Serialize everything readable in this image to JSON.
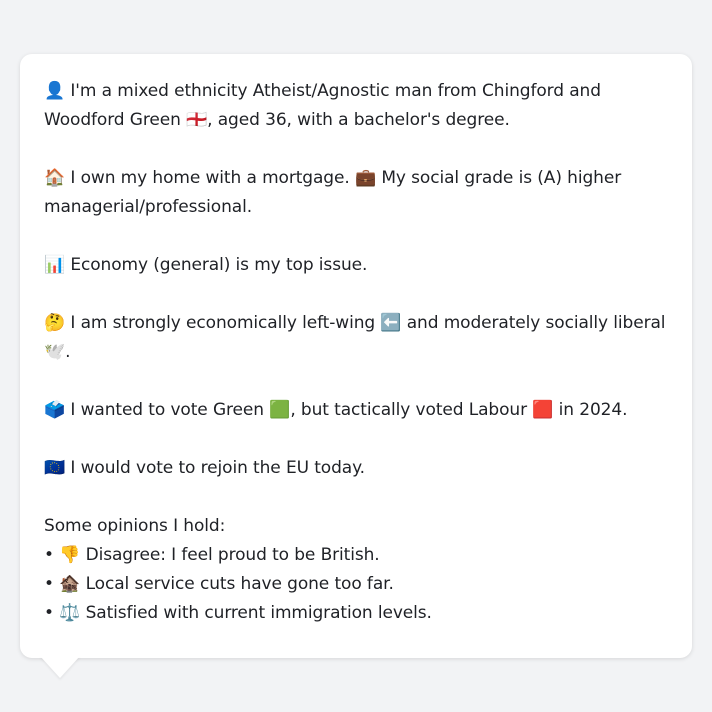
{
  "paragraphs": [
    "👤 I'm a mixed ethnicity Atheist/Agnostic man from Chingford and Woodford Green 🏴󠁧󠁢󠁥󠁮󠁧󠁿, aged 36, with a bachelor's degree.",
    "🏠 I own my home with a mortgage. 💼 My social grade is (A) higher managerial/professional.",
    "📊 Economy (general) is my top issue.",
    "🤔 I am strongly economically left-wing ⬅️ and moderately socially liberal 🕊️.",
    "🗳️ I wanted to vote Green 🟩, but tactically voted Labour 🟥 in 2024.",
    "🇪🇺 I would vote to rejoin the EU today."
  ],
  "opinions": {
    "heading": "Some opinions I hold:",
    "items": [
      "👎 Disagree: I feel proud to be British.",
      "🏚️ Local service cuts have gone too far.",
      "⚖️ Satisfied with current immigration levels."
    ]
  }
}
